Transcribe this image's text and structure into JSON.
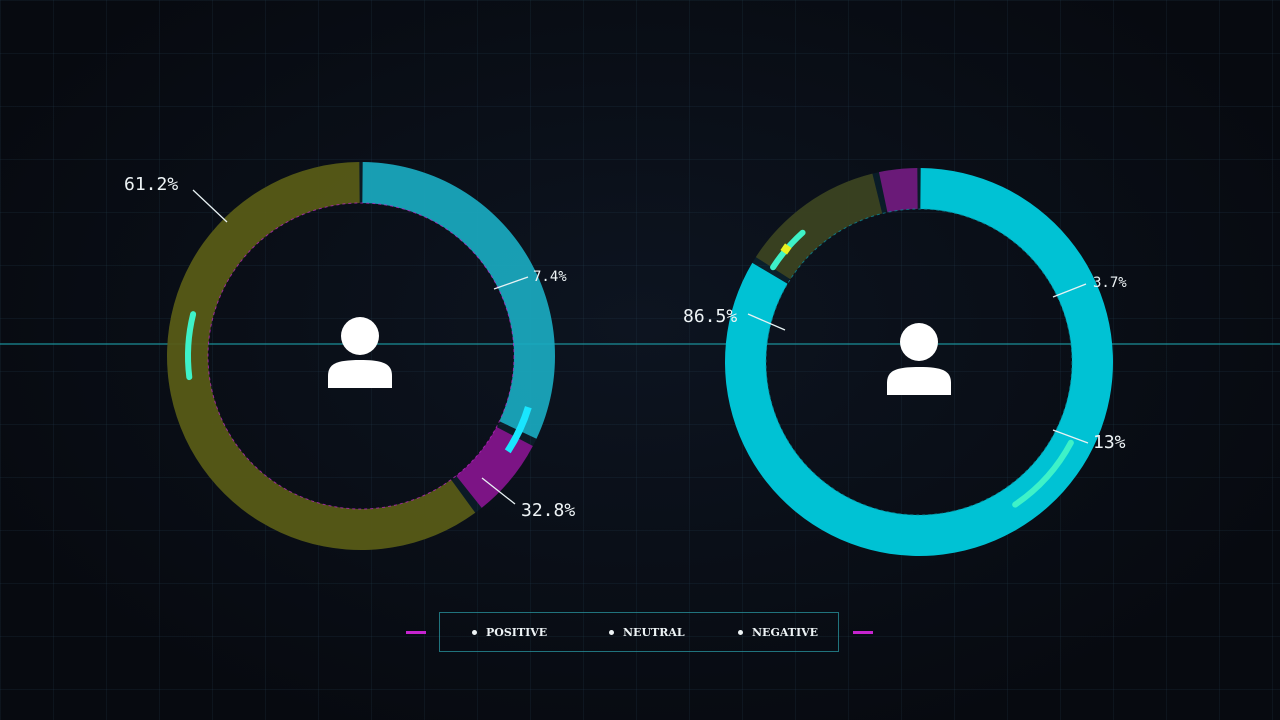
{
  "chart_data": [
    {
      "type": "pie",
      "slices": [
        {
          "label": "POSITIVE",
          "value": 32.8,
          "display": "32.8%",
          "color": "#1aa9bf"
        },
        {
          "label": "NEUTRAL",
          "value": 61.2,
          "display": "61.2%",
          "color": "#5a5d1a"
        },
        {
          "label": "NEGATIVE",
          "value": 7.4,
          "display": "7.4%",
          "color": "#7c1485"
        }
      ],
      "icon": "user-icon"
    },
    {
      "type": "pie",
      "slices": [
        {
          "label": "POSITIVE",
          "value": 86.5,
          "display": "86.5%",
          "color": "#00c2d4"
        },
        {
          "label": "NEUTRAL",
          "value": 13,
          "display": "13%",
          "color": "#3b4220"
        },
        {
          "label": "NEGATIVE",
          "value": 3.7,
          "display": "3.7%",
          "color": "#6a1a78"
        }
      ],
      "icon": "user-icon"
    }
  ],
  "legend": {
    "items": [
      {
        "label": "POSITIVE"
      },
      {
        "label": "NEUTRAL"
      },
      {
        "label": "NEGATIVE"
      }
    ]
  },
  "colors": {
    "accent_line": "#1ea0aa",
    "legend_dash": "#c624cf",
    "highlight": "#3ef2c8"
  }
}
